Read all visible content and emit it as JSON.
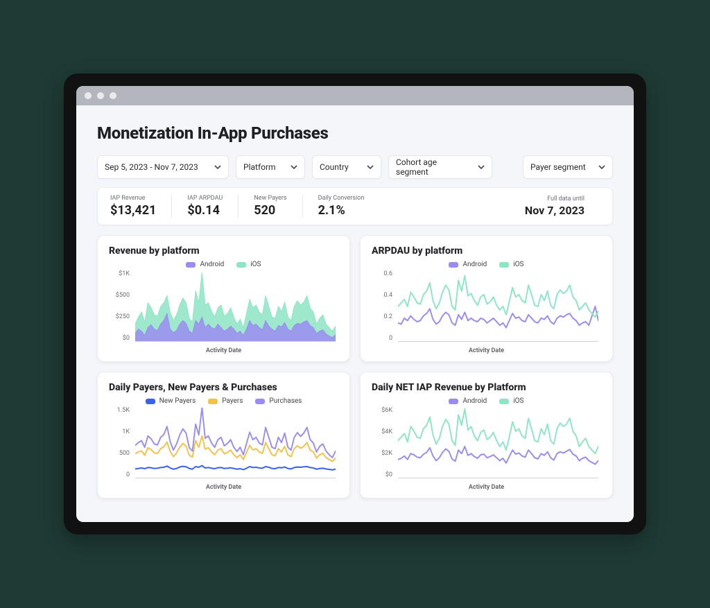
{
  "page_title": "Monetization In-App Purchases",
  "filters": {
    "date_range": "Sep 5, 2023 - Nov 7, 2023",
    "platform": "Platform",
    "country": "Country",
    "cohort": "Cohort age segment",
    "payer": "Payer segment"
  },
  "kpis": {
    "iap_revenue_label": "IAP Revenue",
    "iap_revenue_value": "$13,421",
    "arpdau_label": "IAP ARPDAU",
    "arpdau_value": "$0.14",
    "new_payers_label": "New Payers",
    "new_payers_value": "520",
    "daily_conv_label": "Daily Conversion",
    "daily_conv_value": "2.1%",
    "full_data_label": "Full data until",
    "full_data_value": "Nov 7, 2023"
  },
  "legends": {
    "android": "Android",
    "ios": "iOS",
    "new_payers": "New Payers",
    "payers": "Payers",
    "purchases": "Purchases"
  },
  "axis_labels": {
    "x": "Activity Date"
  },
  "cards": {
    "revenue": {
      "title": "Revenue by platform",
      "y_ticks": [
        "$1K",
        "$500",
        "$250",
        "$0"
      ]
    },
    "arpdau": {
      "title": "ARPDAU by platform",
      "y_ticks": [
        "0.6",
        "0.4",
        "0.2",
        "0"
      ]
    },
    "payers": {
      "title": "Daily Payers, New Payers & Purchases",
      "y_ticks": [
        "1.5K",
        "1K",
        "500",
        "0"
      ]
    },
    "net": {
      "title": "Daily NET IAP Revenue by Platform",
      "y_ticks": [
        "$6K",
        "$4K",
        "$2K",
        "$0"
      ]
    }
  },
  "colors": {
    "android": "#9a8cf0",
    "ios": "#8de5c4",
    "new_payers": "#3a62f0",
    "payers": "#f4c24b",
    "purchases": "#9a8cf0"
  },
  "chart_data": [
    {
      "id": "revenue_by_platform",
      "type": "area",
      "title": "Revenue by platform",
      "xlabel": "Activity Date",
      "ylabel": "",
      "ylim": [
        0,
        1000
      ],
      "y_ticks": [
        0,
        250,
        500,
        1000
      ],
      "x": [
        0,
        1,
        2,
        3,
        4,
        5,
        6,
        7,
        8,
        9,
        10,
        11,
        12,
        13,
        14,
        15,
        16,
        17,
        18,
        19,
        20,
        21,
        22,
        23,
        24,
        25,
        26,
        27,
        28,
        29,
        30,
        31,
        32,
        33,
        34,
        35,
        36,
        37,
        38,
        39,
        40,
        41,
        42,
        43,
        44,
        45,
        46,
        47,
        48,
        49,
        50,
        51,
        52,
        53,
        54,
        55,
        56,
        57,
        58,
        59,
        60,
        61,
        62,
        63
      ],
      "series": [
        {
          "name": "Android",
          "color": "#9a8cf0",
          "values": [
            120,
            180,
            150,
            90,
            200,
            240,
            180,
            160,
            250,
            300,
            400,
            180,
            130,
            160,
            250,
            300,
            260,
            150,
            120,
            300,
            250,
            350,
            200,
            250,
            200,
            180,
            250,
            200,
            150,
            180,
            220,
            180,
            120,
            150,
            90,
            180,
            300,
            230,
            250,
            200,
            170,
            300,
            220,
            180,
            150,
            230,
            210,
            270,
            180,
            150,
            230,
            260,
            250,
            280,
            300,
            230,
            200,
            120,
            150,
            170,
            110,
            80,
            60,
            100
          ]
        },
        {
          "name": "iOS",
          "color": "#8de5c4",
          "values": [
            250,
            350,
            420,
            280,
            550,
            480,
            380,
            360,
            500,
            550,
            650,
            420,
            300,
            380,
            520,
            620,
            550,
            330,
            280,
            720,
            550,
            980,
            520,
            550,
            430,
            350,
            480,
            520,
            360,
            400,
            480,
            350,
            250,
            320,
            200,
            400,
            600,
            480,
            520,
            420,
            380,
            650,
            500,
            350,
            330,
            500,
            430,
            560,
            350,
            300,
            500,
            580,
            520,
            560,
            650,
            480,
            420,
            250,
            330,
            380,
            250,
            200,
            150,
            220
          ]
        }
      ]
    },
    {
      "id": "arpdau_by_platform",
      "type": "line",
      "title": "ARPDAU by platform",
      "xlabel": "Activity Date",
      "ylabel": "",
      "ylim": [
        0,
        0.6
      ],
      "y_ticks": [
        0,
        0.2,
        0.4,
        0.6
      ],
      "x": [
        0,
        1,
        2,
        3,
        4,
        5,
        6,
        7,
        8,
        9,
        10,
        11,
        12,
        13,
        14,
        15,
        16,
        17,
        18,
        19,
        20,
        21,
        22,
        23,
        24,
        25,
        26,
        27,
        28,
        29,
        30,
        31,
        32,
        33,
        34,
        35,
        36,
        37,
        38,
        39,
        40,
        41,
        42,
        43,
        44,
        45,
        46,
        47,
        48,
        49,
        50,
        51,
        52,
        53,
        54,
        55,
        56,
        57,
        58,
        59,
        60,
        61,
        62,
        63
      ],
      "series": [
        {
          "name": "Android",
          "color": "#9a8cf0",
          "values": [
            0.16,
            0.15,
            0.2,
            0.18,
            0.22,
            0.19,
            0.17,
            0.18,
            0.22,
            0.24,
            0.28,
            0.19,
            0.15,
            0.17,
            0.22,
            0.25,
            0.23,
            0.16,
            0.14,
            0.23,
            0.19,
            0.25,
            0.18,
            0.2,
            0.18,
            0.17,
            0.2,
            0.19,
            0.16,
            0.18,
            0.2,
            0.17,
            0.14,
            0.16,
            0.12,
            0.18,
            0.24,
            0.2,
            0.21,
            0.18,
            0.17,
            0.23,
            0.2,
            0.17,
            0.16,
            0.2,
            0.19,
            0.22,
            0.17,
            0.15,
            0.2,
            0.22,
            0.21,
            0.23,
            0.24,
            0.2,
            0.18,
            0.14,
            0.16,
            0.17,
            0.14,
            0.22,
            0.3,
            0.18
          ]
        },
        {
          "name": "iOS",
          "color": "#8de5c4",
          "values": [
            0.3,
            0.33,
            0.36,
            0.3,
            0.42,
            0.38,
            0.33,
            0.32,
            0.4,
            0.43,
            0.5,
            0.35,
            0.28,
            0.33,
            0.42,
            0.48,
            0.44,
            0.3,
            0.27,
            0.52,
            0.43,
            0.56,
            0.39,
            0.41,
            0.35,
            0.31,
            0.38,
            0.4,
            0.32,
            0.34,
            0.38,
            0.31,
            0.27,
            0.3,
            0.23,
            0.34,
            0.46,
            0.38,
            0.4,
            0.35,
            0.33,
            0.48,
            0.4,
            0.31,
            0.3,
            0.4,
            0.35,
            0.43,
            0.31,
            0.28,
            0.4,
            0.44,
            0.41,
            0.43,
            0.48,
            0.38,
            0.35,
            0.27,
            0.3,
            0.33,
            0.27,
            0.24,
            0.21,
            0.26
          ]
        }
      ]
    },
    {
      "id": "daily_payers_new_payers_purchases",
      "type": "line",
      "title": "Daily Payers, New Payers & Purchases",
      "xlabel": "Activity Date",
      "ylabel": "",
      "ylim": [
        0,
        1500
      ],
      "y_ticks": [
        0,
        500,
        1000,
        1500
      ],
      "x": [
        0,
        1,
        2,
        3,
        4,
        5,
        6,
        7,
        8,
        9,
        10,
        11,
        12,
        13,
        14,
        15,
        16,
        17,
        18,
        19,
        20,
        21,
        22,
        23,
        24,
        25,
        26,
        27,
        28,
        29,
        30,
        31,
        32,
        33,
        34,
        35,
        36,
        37,
        38,
        39,
        40,
        41,
        42,
        43,
        44,
        45,
        46,
        47,
        48,
        49,
        50,
        51,
        52,
        53,
        54,
        55,
        56,
        57,
        58,
        59,
        60,
        61,
        62,
        63
      ],
      "series": [
        {
          "name": "New Payers",
          "color": "#3a62f0",
          "values": [
            200,
            210,
            220,
            205,
            230,
            225,
            210,
            215,
            230,
            235,
            260,
            220,
            195,
            210,
            240,
            255,
            245,
            210,
            195,
            250,
            235,
            270,
            220,
            230,
            215,
            205,
            225,
            230,
            210,
            215,
            225,
            210,
            195,
            205,
            185,
            215,
            250,
            230,
            235,
            220,
            215,
            250,
            235,
            210,
            205,
            230,
            225,
            240,
            210,
            200,
            230,
            240,
            235,
            245,
            250,
            230,
            220,
            195,
            210,
            215,
            200,
            190,
            180,
            195
          ]
        },
        {
          "name": "Payers",
          "color": "#f4c24b",
          "values": [
            520,
            560,
            580,
            490,
            650,
            610,
            540,
            530,
            630,
            670,
            770,
            570,
            460,
            540,
            660,
            740,
            680,
            490,
            450,
            800,
            660,
            900,
            620,
            650,
            560,
            500,
            600,
            630,
            520,
            550,
            600,
            500,
            440,
            500,
            400,
            550,
            700,
            600,
            630,
            560,
            530,
            760,
            630,
            500,
            480,
            630,
            560,
            680,
            500,
            460,
            630,
            690,
            640,
            680,
            760,
            600,
            560,
            430,
            500,
            530,
            440,
            400,
            360,
            430
          ]
        },
        {
          "name": "Purchases",
          "color": "#9a8cf0",
          "values": [
            700,
            760,
            800,
            660,
            900,
            840,
            730,
            710,
            870,
            930,
            1100,
            780,
            600,
            730,
            920,
            1050,
            960,
            650,
            580,
            1150,
            920,
            1500,
            850,
            900,
            750,
            660,
            820,
            870,
            690,
            740,
            820,
            660,
            570,
            660,
            500,
            740,
            980,
            820,
            870,
            750,
            710,
            1080,
            870,
            660,
            630,
            870,
            760,
            960,
            660,
            600,
            870,
            970,
            890,
            960,
            1080,
            820,
            750,
            560,
            680,
            730,
            580,
            500,
            440,
            580
          ]
        }
      ]
    },
    {
      "id": "daily_net_iap_revenue_by_platform",
      "type": "line",
      "title": "Daily NET IAP Revenue by Platform",
      "xlabel": "Activity Date",
      "ylabel": "",
      "ylim": [
        0,
        6000
      ],
      "y_ticks": [
        0,
        2000,
        4000,
        6000
      ],
      "x": [
        0,
        1,
        2,
        3,
        4,
        5,
        6,
        7,
        8,
        9,
        10,
        11,
        12,
        13,
        14,
        15,
        16,
        17,
        18,
        19,
        20,
        21,
        22,
        23,
        24,
        25,
        26,
        27,
        28,
        29,
        30,
        31,
        32,
        33,
        34,
        35,
        36,
        37,
        38,
        39,
        40,
        41,
        42,
        43,
        44,
        45,
        46,
        47,
        48,
        49,
        50,
        51,
        52,
        53,
        54,
        55,
        56,
        57,
        58,
        59,
        60,
        61,
        62,
        63
      ],
      "series": [
        {
          "name": "Android",
          "color": "#9a8cf0",
          "values": [
            1600,
            1700,
            1900,
            1600,
            2100,
            2000,
            1800,
            1750,
            2050,
            2200,
            2600,
            1900,
            1500,
            1750,
            2200,
            2500,
            2300,
            1650,
            1450,
            2400,
            2100,
            2700,
            1950,
            2100,
            1850,
            1700,
            2000,
            2050,
            1750,
            1850,
            2000,
            1750,
            1500,
            1700,
            1300,
            1850,
            2400,
            2050,
            2150,
            1900,
            1800,
            2400,
            2100,
            1750,
            1650,
            2100,
            1950,
            2250,
            1750,
            1550,
            2100,
            2250,
            2150,
            2300,
            2450,
            2050,
            1900,
            1500,
            1700,
            1800,
            1500,
            1350,
            1200,
            1500
          ]
        },
        {
          "name": "iOS",
          "color": "#8de5c4",
          "values": [
            3200,
            3500,
            3800,
            3100,
            4400,
            4000,
            3500,
            3400,
            4200,
            4500,
            5200,
            3700,
            2900,
            3400,
            4400,
            5000,
            4600,
            3200,
            2800,
            5400,
            4500,
            5900,
            4100,
            4400,
            3600,
            3200,
            3900,
            4100,
            3300,
            3500,
            3900,
            3200,
            2700,
            3100,
            2400,
            3500,
            4800,
            4000,
            4200,
            3600,
            3400,
            5100,
            4200,
            3200,
            3100,
            4200,
            3700,
            4600,
            3200,
            2900,
            4200,
            4700,
            4400,
            4600,
            5100,
            4000,
            3600,
            2700,
            3100,
            3400,
            2700,
            2400,
            2100,
            2700
          ]
        }
      ]
    }
  ]
}
